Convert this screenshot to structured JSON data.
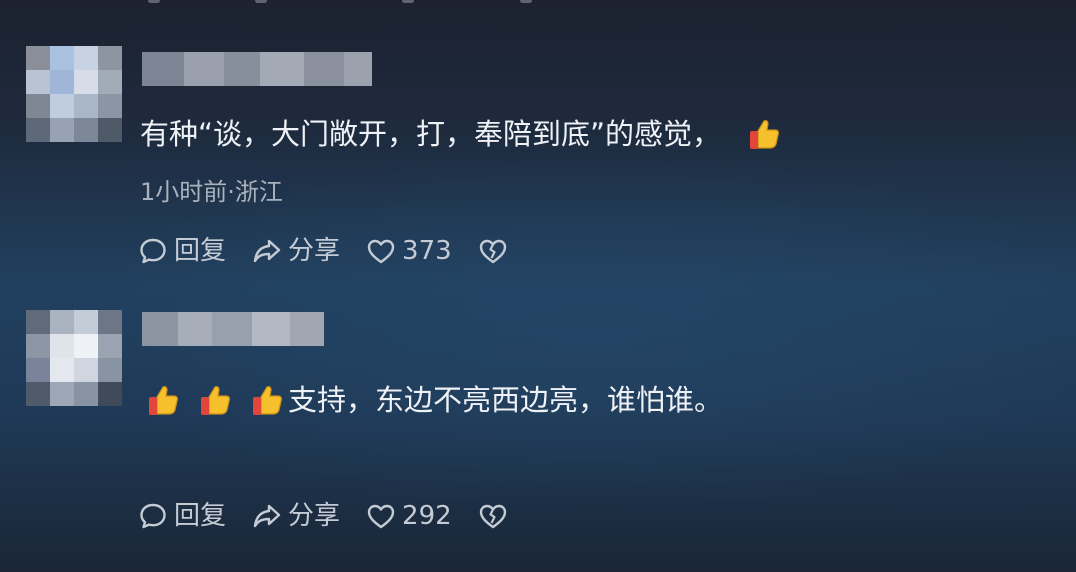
{
  "comments": [
    {
      "text_prefix": "有种“谈，大门敞开，打，奉陪到底”的感觉，",
      "trailing_emoji": "thumbs-up",
      "meta": "1小时前·浙江",
      "reply_label": "回复",
      "share_label": "分享",
      "like_count": "373"
    },
    {
      "leading_emoji_count": 3,
      "text": "支持，东边不亮西边亮，谁怕谁。",
      "reply_label": "回复",
      "share_label": "分享",
      "like_count": "292"
    }
  ],
  "icons": {
    "reply": "speech-bubble-icon",
    "share": "share-arrow-icon",
    "like": "heart-icon",
    "dislike": "broken-heart-icon",
    "emoji": "thumbs-up-icon"
  },
  "colors": {
    "text": "#eef1f5",
    "meta": "#aab2bd",
    "actions": "#c4cbd4",
    "thumb": "#f5c02c",
    "cuff": "#e2463b"
  }
}
